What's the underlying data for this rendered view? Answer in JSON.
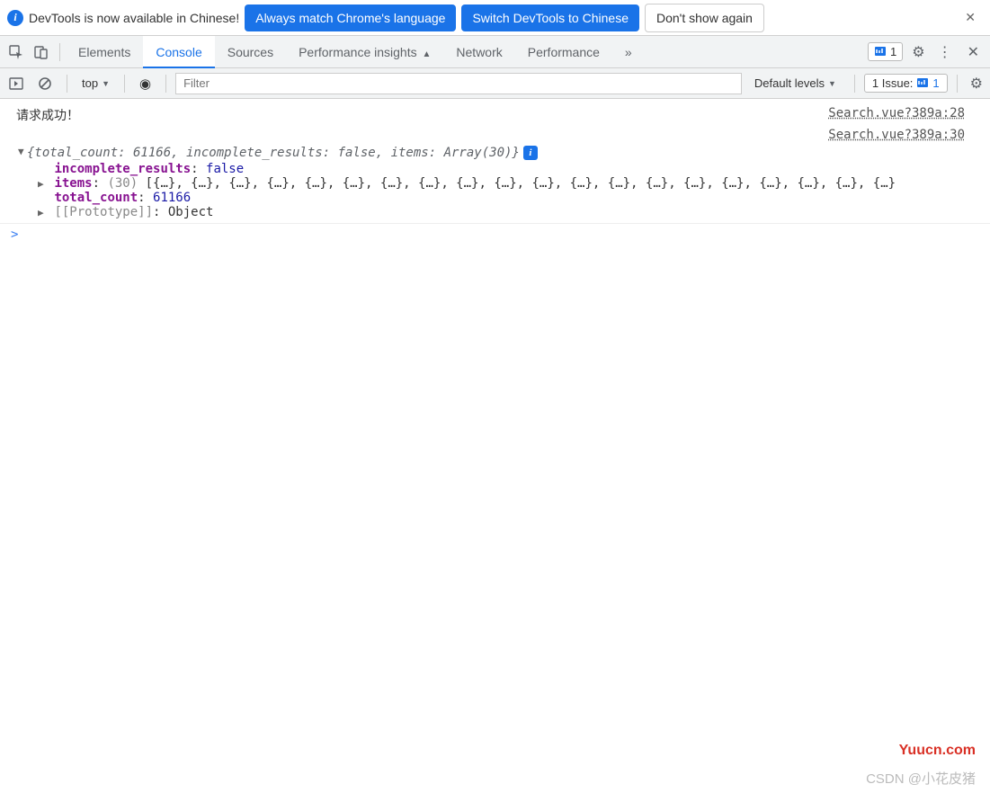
{
  "banner": {
    "text": "DevTools is now available in Chinese!",
    "btn_match": "Always match Chrome's language",
    "btn_switch": "Switch DevTools to Chinese",
    "btn_dont": "Don't show again"
  },
  "tabs": {
    "elements": "Elements",
    "console": "Console",
    "sources": "Sources",
    "perf_insights": "Performance insights",
    "network": "Network",
    "performance": "Performance",
    "issue_count": "1"
  },
  "toolbar": {
    "context": "top",
    "filter_placeholder": "Filter",
    "levels": "Default levels",
    "issues_label": "1 Issue:",
    "issues_count": "1"
  },
  "console": {
    "msg1": "请求成功！",
    "src1": "Search.vue?389a:28",
    "src2": "Search.vue?389a:30",
    "summary_open": "{total_count: 61166, incomplete_results: false, items: Array(30)}",
    "incomplete_key": "incomplete_results",
    "incomplete_val": "false",
    "items_key": "items",
    "items_count": "(30)",
    "items_preview": "[{…}, {…}, {…}, {…}, {…}, {…}, {…}, {…}, {…}, {…}, {…}, {…}, {…}, {…}, {…}, {…}, {…}, {…}, {…}, {…}",
    "total_key": "total_count",
    "total_val": "61166",
    "proto_key": "[[Prototype]]",
    "proto_val": "Object",
    "prompt": ">"
  },
  "footer": {
    "wm1": "Yuucn.com",
    "wm2": "CSDN @小花皮猪"
  }
}
